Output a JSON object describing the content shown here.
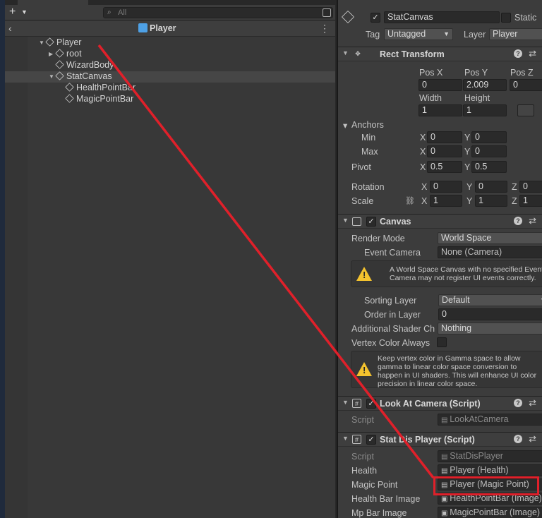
{
  "hierarchy": {
    "search_placeholder": "All",
    "scene_title": "Player",
    "tree": [
      {
        "label": "Player"
      },
      {
        "label": "root"
      },
      {
        "label": "WizardBody"
      },
      {
        "label": "StatCanvas"
      },
      {
        "label": "HealthPointBar"
      },
      {
        "label": "MagicPointBar"
      }
    ]
  },
  "inspector": {
    "object_name": "StatCanvas",
    "static_label": "Static",
    "tag_label": "Tag",
    "tag_value": "Untagged",
    "layer_label": "Layer",
    "layer_value": "Player",
    "rect_transform": {
      "title": "Rect Transform",
      "pos_x_label": "Pos X",
      "pos_y_label": "Pos Y",
      "pos_z_label": "Pos Z",
      "pos_x": "0",
      "pos_y": "2.009",
      "pos_z": "0",
      "width_label": "Width",
      "height_label": "Height",
      "width": "1",
      "height": "1",
      "anchors_label": "Anchors",
      "min_label": "Min",
      "max_label": "Max",
      "min_x": "0",
      "min_y": "0",
      "max_x": "0",
      "max_y": "0",
      "pivot_label": "Pivot",
      "pivot_x": "0.5",
      "pivot_y": "0.5",
      "rotation_label": "Rotation",
      "rot_x": "0",
      "rot_y": "0",
      "rot_z": "0",
      "scale_label": "Scale",
      "scale_x": "1",
      "scale_y": "1",
      "scale_z": "1",
      "x": "X",
      "y": "Y",
      "z": "Z"
    },
    "canvas": {
      "title": "Canvas",
      "render_mode_label": "Render Mode",
      "render_mode": "World Space",
      "event_camera_label": "Event Camera",
      "event_camera": "None (Camera)",
      "warning1": "A World Space Canvas with no specified Event Camera may not register UI events correctly.",
      "sorting_layer_label": "Sorting Layer",
      "sorting_layer": "Default",
      "order_label": "Order in Layer",
      "order": "0",
      "shader_label": "Additional Shader Ch",
      "shader_value": "Nothing",
      "vertex_label": "Vertex Color Always",
      "warning2": "Keep vertex color in Gamma space to allow gamma to linear color space conversion to happen in UI shaders. This will enhance UI color precision in linear color space."
    },
    "look_at": {
      "title": "Look At Camera (Script)",
      "script_label": "Script",
      "script_value": "LookAtCamera"
    },
    "stat_dis": {
      "title": "Stat Dis Player (Script)",
      "script_label": "Script",
      "script_value": "StatDisPlayer",
      "health_label": "Health",
      "health_value": "Player (Health)",
      "magic_label": "Magic Point",
      "magic_value": "Player (Magic Point)",
      "hbar_label": "Health Bar Image",
      "hbar_value": "HealthPointBar (Image)",
      "mpbar_label": "Mp Bar Image",
      "mpbar_value": "MagicPointBar (Image)"
    }
  },
  "colors": {
    "annotation": "#e0202a",
    "warning": "#f3c22e"
  }
}
